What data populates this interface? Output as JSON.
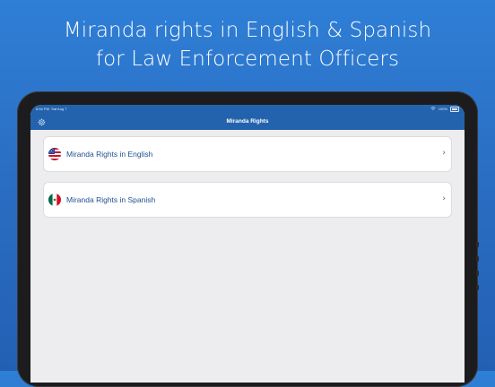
{
  "headline": {
    "line1": "Miranda rights in English & Spanish",
    "line2": "for Law Enforcement Officers"
  },
  "statusbar": {
    "time": "8:54 PM",
    "date": "Sat Aug 7",
    "battery": "100%"
  },
  "navbar": {
    "title": "Miranda Rights",
    "settings_icon": "gear-icon"
  },
  "list": {
    "items": [
      {
        "label": "Miranda Rights in English",
        "flag": "us-flag-icon"
      },
      {
        "label": "Miranda Rights in Spanish",
        "flag": "mexico-flag-icon"
      }
    ]
  },
  "colors": {
    "background_top": "#2f7fd6",
    "navbar": "#2363ad",
    "label": "#1f4f94",
    "screen_bg": "#ededf0"
  }
}
